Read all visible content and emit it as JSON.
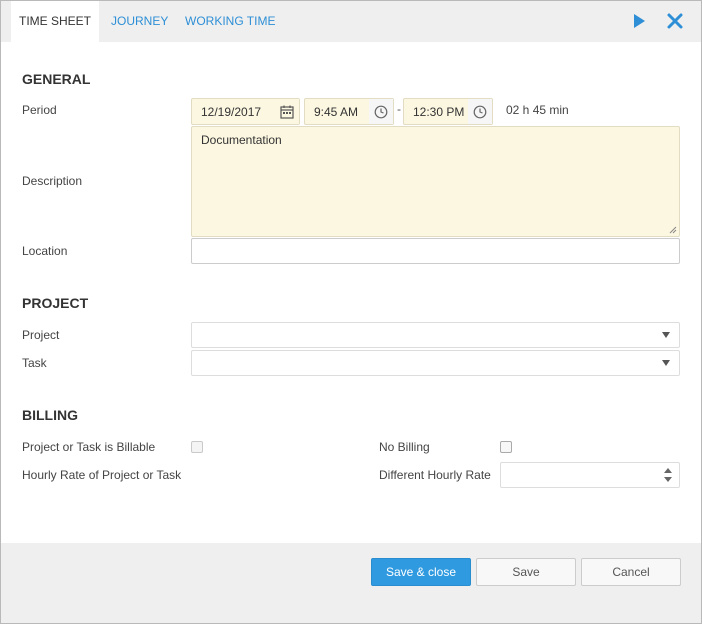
{
  "tabs": {
    "timesheet": "TIME SHEET",
    "journey": "JOURNEY",
    "working_time": "WORKING TIME"
  },
  "header_icons": {
    "play": "play-icon",
    "close": "close-icon"
  },
  "general": {
    "title": "GENERAL",
    "period_label": "Period",
    "date": "12/19/2017",
    "start_time": "9:45 AM",
    "separator": "-",
    "end_time": "12:30 PM",
    "duration": "02 h 45 min",
    "description_label": "Description",
    "description_value": "Documentation",
    "location_label": "Location",
    "location_value": ""
  },
  "project": {
    "title": "PROJECT",
    "project_label": "Project",
    "project_value": "",
    "task_label": "Task",
    "task_value": ""
  },
  "billing": {
    "title": "BILLING",
    "billable_label": "Project or Task is Billable",
    "billable_checked": false,
    "no_billing_label": "No Billing",
    "no_billing_checked": false,
    "hourly_rate_label": "Hourly Rate of Project or Task",
    "different_rate_label": "Different Hourly Rate",
    "different_rate_value": ""
  },
  "footer": {
    "save_close": "Save & close",
    "save": "Save",
    "cancel": "Cancel"
  },
  "colors": {
    "accent": "#2f9ae0",
    "tab_link": "#2e8fd6",
    "field_bg": "#fcf7e1"
  }
}
